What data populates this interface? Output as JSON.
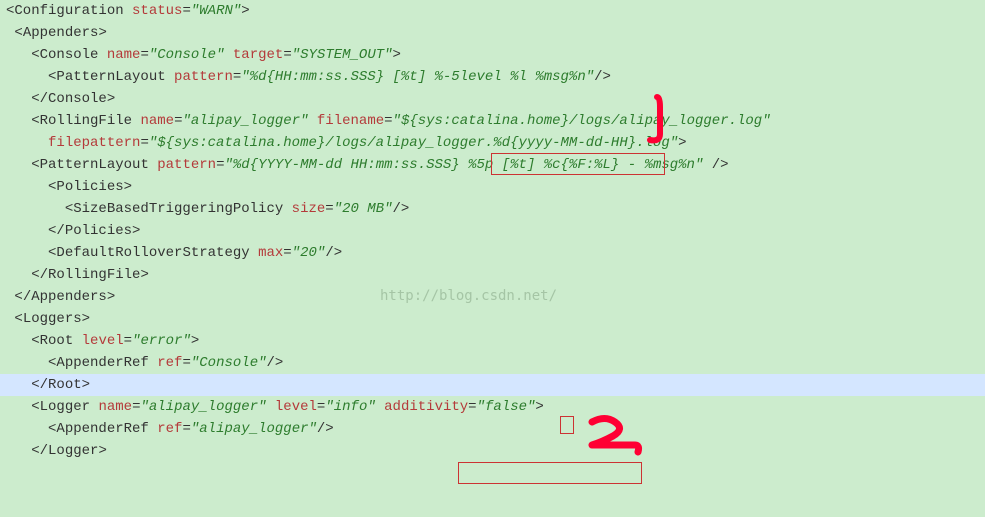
{
  "lines": {
    "l1_tag": "Configuration",
    "l1_attr1": "status",
    "l1_val1": "WARN",
    "l2_tag": "Appenders",
    "l3_tag": "Console",
    "l3_attr1": "name",
    "l3_val1": "Console",
    "l3_attr2": "target",
    "l3_val2": "SYSTEM_OUT",
    "l4_tag": "PatternLayout",
    "l4_attr1": "pattern",
    "l4_val1": "%d{HH:mm:ss.SSS} [%t] %-5level %l %msg%n",
    "l5_tag": "/Console",
    "l6_tag": "RollingFile",
    "l6_attr1": "name",
    "l6_val1": "alipay_logger",
    "l6_attr2": "filename",
    "l6_val2a": "${",
    "l6_val2b": "sys:catalina.home",
    "l6_val2c": "}/logs/alipay_logger.log",
    "l7_attr1": "filepattern",
    "l7_val1": "${sys:catalina.home}/logs/alipay_logger.%d{yyyy-MM-dd-HH}.log",
    "l8_tag": "PatternLayout",
    "l8_attr1": "pattern",
    "l8_val1": "%d{YYYY-MM-dd HH:mm:ss.SSS} %5p [%t] %c{%F:%L} - %msg%n",
    "l9_tag": "Policies",
    "l10_tag": "SizeBasedTriggeringPolicy",
    "l10_attr1": "size",
    "l10_val1": "20 MB",
    "l11_tag": "/Policies",
    "l12_tag": "DefaultRolloverStrategy",
    "l12_attr1": "max",
    "l12_val1": "20",
    "l13_tag": "/RollingFile",
    "l14_tag": "/Appenders",
    "l15_tag": "Loggers",
    "l16_tag": "Root",
    "l16_attr1": "level",
    "l16_val1": "error",
    "l17_tag": "AppenderRef",
    "l17_attr1": "ref",
    "l17_val1": "Console",
    "l18_tag": "/Root",
    "l19_tag": "Logger",
    "l19_attr1": "name",
    "l19_val1": "alipay_logger",
    "l19_attr2": "level",
    "l19_val2": "info",
    "l19_attr3": "additivity",
    "l19_val3": "false",
    "l20_tag": "AppenderRef",
    "l20_attr1": "ref",
    "l20_val1": "alipay_logger",
    "l21_tag": "/Logger"
  },
  "watermark": "http://blog.csdn.net/",
  "annotations": {
    "mark1": "1",
    "mark2": "2"
  }
}
